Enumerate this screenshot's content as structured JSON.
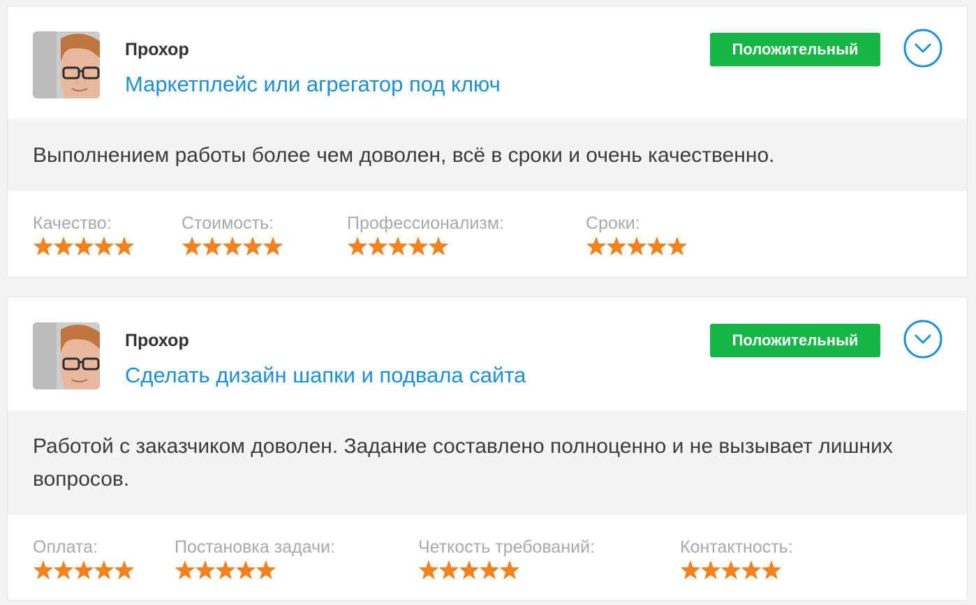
{
  "colors": {
    "link": "#1c8fd6",
    "badge": "#15b546",
    "star": "#f2821f",
    "toggle": "#1c8fd6"
  },
  "reviews": [
    {
      "author": "Прохор",
      "project": "Маркетплейс или агрегатор под ключ",
      "badge": "Положительный",
      "text": "Выполнением работы более чем доволен, всё в сроки и очень качественно.",
      "toggle_icon": "chevron-down-circle-icon",
      "ratings": [
        {
          "label": "Качество:",
          "stars": 5
        },
        {
          "label": "Стоимость:",
          "stars": 5
        },
        {
          "label": "Профессионализм:",
          "stars": 5
        },
        {
          "label": "Сроки:",
          "stars": 5
        }
      ]
    },
    {
      "author": "Прохор",
      "project": "Сделать дизайн шапки и подвала сайта",
      "badge": "Положительный",
      "text": "Работой с заказчиком доволен. Задание составлено полноценно и не вызывает лишних вопросов.",
      "toggle_icon": "chevron-down-circle-icon",
      "ratings": [
        {
          "label": "Оплата:",
          "stars": 5
        },
        {
          "label": "Постановка задачи:",
          "stars": 5
        },
        {
          "label": "Четкость требований:",
          "stars": 5
        },
        {
          "label": "Контактность:",
          "stars": 5
        }
      ]
    }
  ]
}
